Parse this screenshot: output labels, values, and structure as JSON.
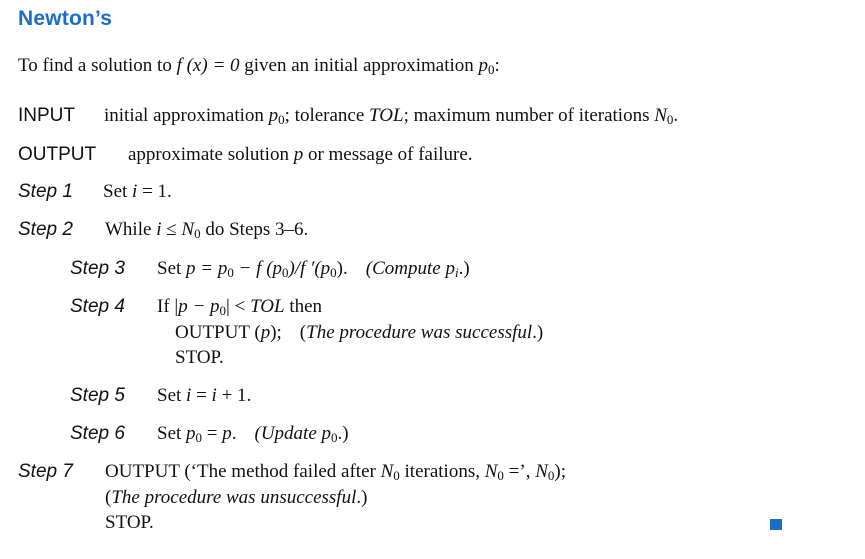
{
  "heading": "Newton’s",
  "intro": {
    "text_before": "To find a solution to ",
    "equation": "f (x) = 0",
    "text_after": " given an initial approximation ",
    "var": "p",
    "sub": "0",
    "end": ":"
  },
  "input": {
    "label": "INPUT",
    "t1": "initial approximation ",
    "var_p": "p",
    "sub0": "0",
    "t2": "; tolerance ",
    "tol": "TOL",
    "t3": "; maximum number of iterations ",
    "var_N": "N",
    "end": "."
  },
  "output": {
    "label": "OUTPUT",
    "t1": "approximate solution ",
    "var_p": "p",
    "t2": " or message of failure."
  },
  "steps": [
    {
      "label": "Step 1",
      "t1": "Set ",
      "var": "i",
      "t2": " = 1."
    },
    {
      "label": "Step 2",
      "t1": "While ",
      "var": "i",
      "t2": " ≤ ",
      "var2": "N",
      "sub": "0",
      "t3": " do Steps 3–6."
    },
    {
      "label": "Step 3",
      "t1": "Set ",
      "expr": "p = p",
      "sub": "0",
      "expr2": " − f (p",
      "expr3": ")/f ′(p",
      "expr4": ").",
      "comment": "(Compute ",
      "comment_var": "p",
      "comment_sub": "i",
      "comment_end": ".)"
    },
    {
      "label": "Step 4",
      "t1": "If |",
      "expr": "p − p",
      "sub": "0",
      "t2": "| < ",
      "tol": "TOL",
      "t3": " then",
      "line2_a": "OUTPUT (",
      "line2_var": "p",
      "line2_b": ");",
      "line2_comment": "(The procedure was successful.)",
      "line3": "STOP."
    },
    {
      "label": "Step 5",
      "t1": "Set ",
      "var": "i",
      "t2": " = ",
      "var2": "i",
      "t3": " + 1."
    },
    {
      "label": "Step 6",
      "t1": "Set ",
      "var": "p",
      "sub": "0",
      "t2": " = ",
      "var2": "p",
      "t3": ".",
      "comment": "(Update  ",
      "comment_var": "p",
      "comment_sub": "0",
      "comment_end": ".)"
    },
    {
      "label": "Step 7",
      "t1": "OUTPUT (‘The method failed after ",
      "var": "N",
      "sub": "0",
      "t2": " iterations, ",
      "var2": "N",
      "t3": " =’, ",
      "var3": "N",
      "t4": ");",
      "line2": "(The procedure was unsuccessful.)",
      "line3": "STOP."
    }
  ],
  "accent_color": "#1a6ec7"
}
